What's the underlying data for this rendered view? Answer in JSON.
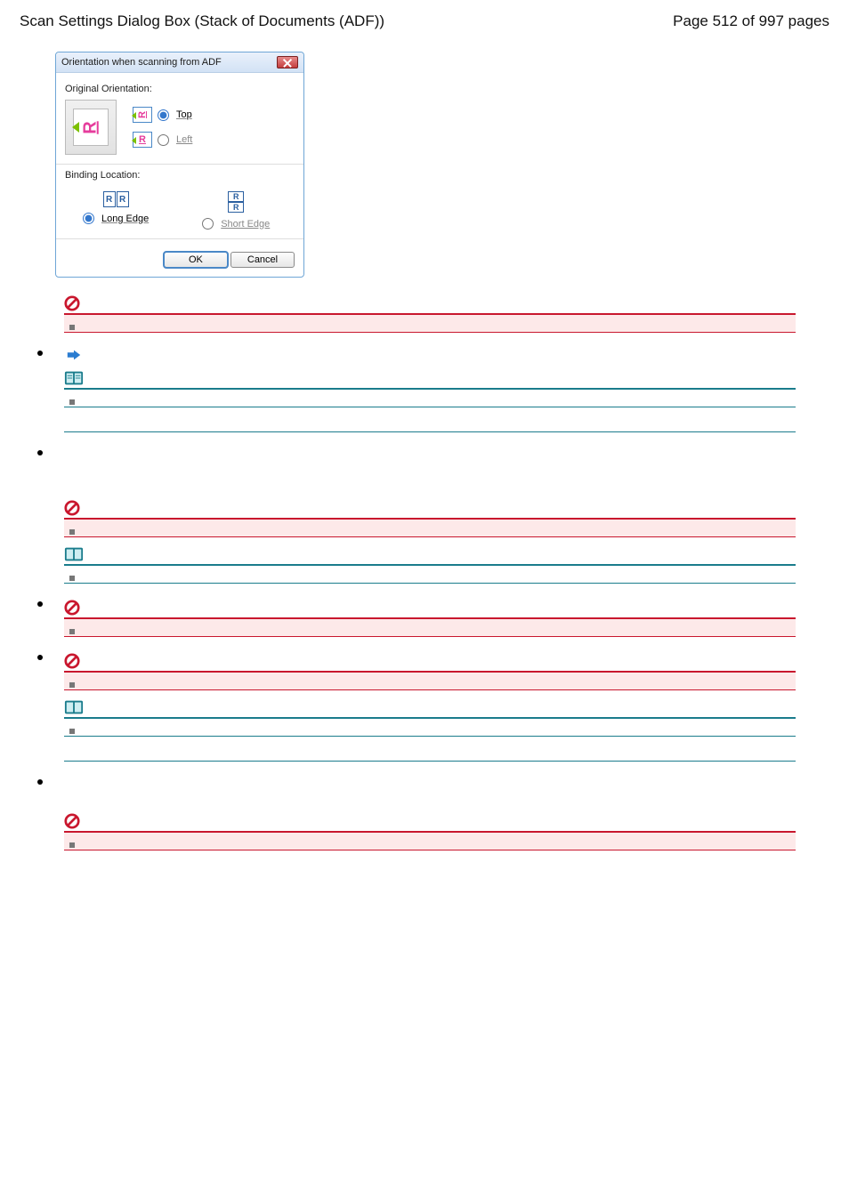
{
  "header": {
    "topic": "Scan Settings Dialog Box (Stack of Documents (ADF))",
    "page_location": "Page 512 of 997 pages"
  },
  "dialog": {
    "title": "Orientation when scanning from ADF",
    "original_label": "Original Orientation:",
    "top_label": "Top",
    "left_label": "Left",
    "binding_label": "Binding Location:",
    "long_edge_label": "Long Edge",
    "short_edge_label": "Short Edge",
    "ok_label": "OK",
    "cancel_label": "Cancel"
  }
}
